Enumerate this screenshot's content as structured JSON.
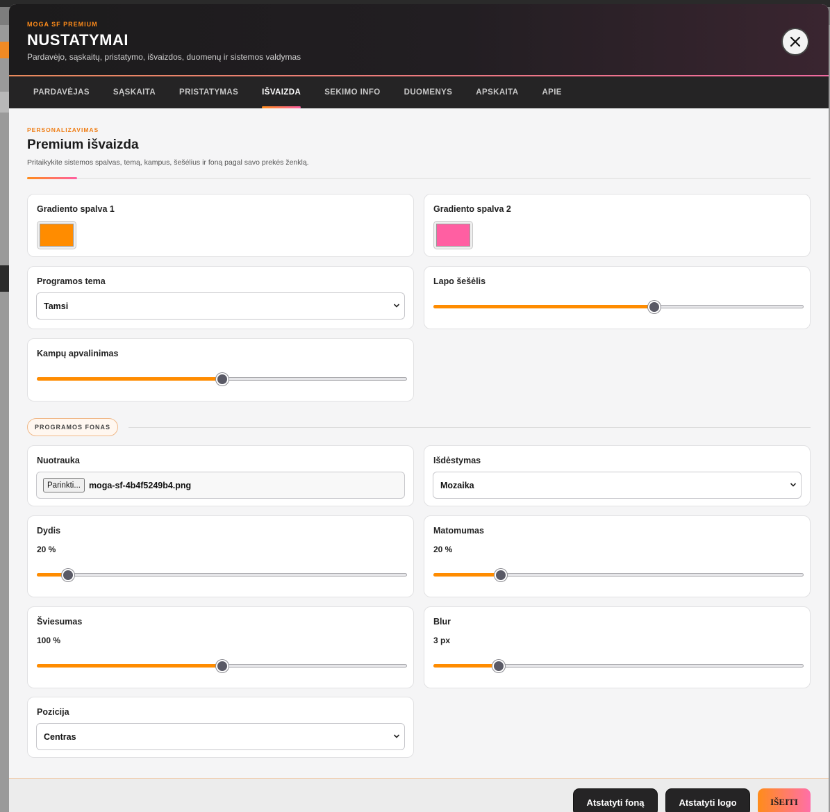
{
  "header": {
    "eyebrow": "MOGA SF PREMIUM",
    "title": "NUSTATYMAI",
    "subtitle": "Pardavėjo, sąskaitų, pristatymo, išvaizdos, duomenų ir sistemos valdymas"
  },
  "tabs": [
    {
      "label": "PARDAVĖJAS"
    },
    {
      "label": "SĄSKAITA"
    },
    {
      "label": "PRISTATYMAS"
    },
    {
      "label": "IŠVAIZDA",
      "active": true
    },
    {
      "label": "SEKIMO INFO"
    },
    {
      "label": "DUOMENYS"
    },
    {
      "label": "APSKAITA"
    },
    {
      "label": "APIE"
    }
  ],
  "section": {
    "eyebrow": "PERSONALIZAVIMAS",
    "title": "Premium išvaizda",
    "description": "Pritaikykite sistemos spalvas, temą, kampus, šešėlius ir foną pagal savo prekės ženklą."
  },
  "appearance": {
    "gradient1": {
      "label": "Gradiento spalva 1",
      "color": "#ff8c00"
    },
    "gradient2": {
      "label": "Gradiento spalva 2",
      "color": "#ff5fa2"
    },
    "theme": {
      "label": "Programos tema",
      "value": "Tamsi"
    },
    "shadow": {
      "label": "Lapo šešėlis",
      "level": 0.6
    },
    "radius": {
      "label": "Kampų apvalinimas",
      "level": 0.5
    }
  },
  "background": {
    "divider_label": "PROGRAMOS FONAS",
    "photo": {
      "label": "Nuotrauka",
      "button": "Parinkti...",
      "filename": "moga-sf-4b4f5249b4.png"
    },
    "layout": {
      "label": "Išdėstymas",
      "value": "Mozaika"
    },
    "size": {
      "label": "Dydis",
      "value": "20 %",
      "level": 0.07
    },
    "opacity": {
      "label": "Matomumas",
      "value": "20 %",
      "level": 0.17
    },
    "brightness": {
      "label": "Šviesumas",
      "value": "100 %",
      "level": 0.5
    },
    "blur": {
      "label": "Blur",
      "value": "3 px",
      "level": 0.165
    },
    "position": {
      "label": "Pozicija",
      "value": "Centras"
    }
  },
  "footer": {
    "reset_bg": "Atstatyti foną",
    "reset_logo": "Atstatyti logo",
    "exit": "IŠEITI"
  },
  "colors": {
    "accent": "#ff8c00",
    "accent2": "#ff5fa2",
    "dark": "#252425"
  }
}
